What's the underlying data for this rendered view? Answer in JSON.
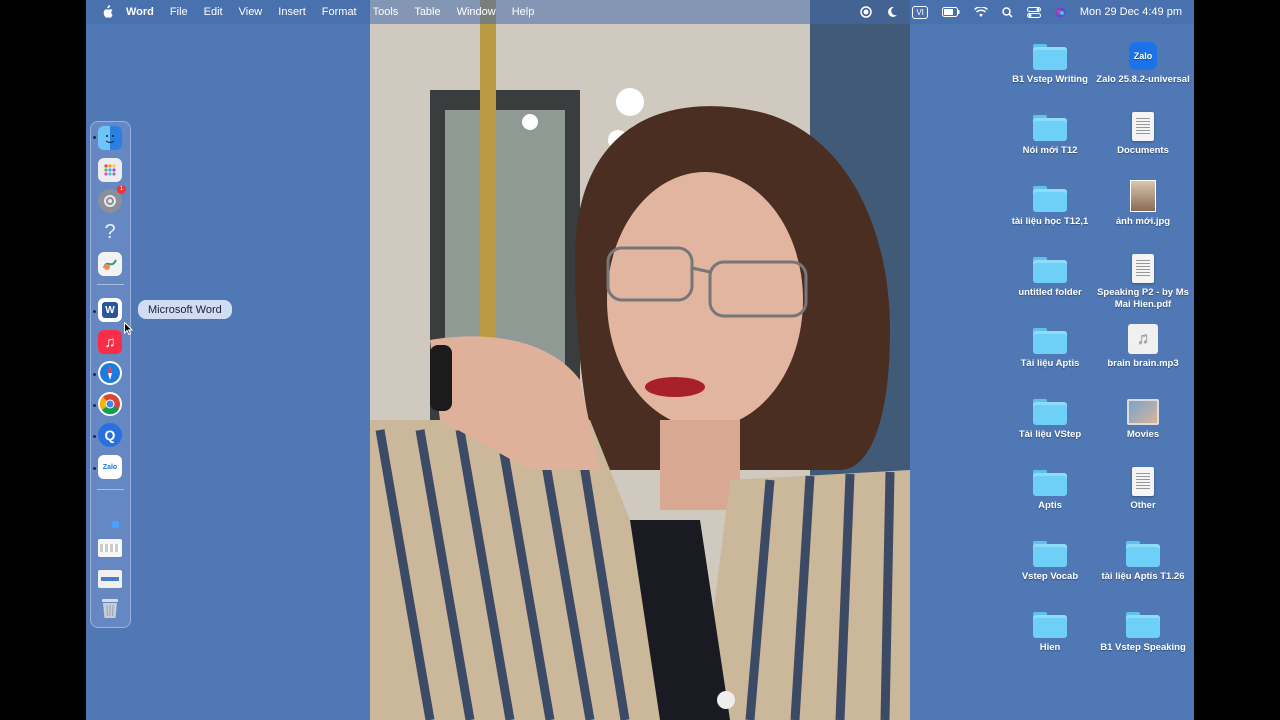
{
  "menubar": {
    "app_name": "Word",
    "menus": [
      "File",
      "Edit",
      "View",
      "Insert",
      "Format",
      "Tools",
      "Table",
      "Window",
      "Help"
    ],
    "input_source": "VI",
    "datetime": "Mon 29 Dec  4:49 pm"
  },
  "dock": {
    "tooltip": "Microsoft Word",
    "apps": [
      {
        "name": "finder-icon",
        "color": "#3a8ee6",
        "label": ""
      },
      {
        "name": "launchpad-icon",
        "color": "#e9e9ee",
        "label": ""
      },
      {
        "name": "system-settings-icon",
        "color": "#8a8f99",
        "label": "",
        "badge": "1"
      },
      {
        "name": "help-icon",
        "color": "transparent",
        "label": "?"
      },
      {
        "name": "freeform-icon",
        "color": "#f4f4f4",
        "label": ""
      },
      {
        "name": "microsoft-word-icon",
        "color": "#2b579a",
        "label": "W"
      },
      {
        "name": "music-icon",
        "color": "#fa2d48",
        "label": "♫"
      },
      {
        "name": "safari-icon",
        "color": "#1f7ae0",
        "label": ""
      },
      {
        "name": "chrome-icon",
        "color": "#ffffff",
        "label": ""
      },
      {
        "name": "quicktime-icon",
        "color": "#2a6fe0",
        "label": "Q"
      },
      {
        "name": "zalo-icon",
        "color": "#ffffff",
        "label": "Zalo"
      }
    ]
  },
  "desktop": {
    "items": [
      {
        "label": "B1 Vstep Writing",
        "type": "folder"
      },
      {
        "label": "Zalo 25.8.2-universal",
        "type": "zalo"
      },
      {
        "label": "Nói mới T12",
        "type": "folder"
      },
      {
        "label": "Documents",
        "type": "doc"
      },
      {
        "label": "tài liệu học T12,1",
        "type": "folder"
      },
      {
        "label": "ảnh mới.jpg",
        "type": "image"
      },
      {
        "label": "untitled folder",
        "type": "folder"
      },
      {
        "label": "Speaking P2 - by Ms Mai Hien.pdf",
        "type": "doc"
      },
      {
        "label": "Tài liệu Aptis",
        "type": "folder"
      },
      {
        "label": "brain brain.mp3",
        "type": "audio"
      },
      {
        "label": "Tài liệu VStep",
        "type": "folder"
      },
      {
        "label": "Movies",
        "type": "movie"
      },
      {
        "label": "Aptis",
        "type": "folder"
      },
      {
        "label": "Other",
        "type": "doc"
      },
      {
        "label": "Vstep Vocab",
        "type": "folder"
      },
      {
        "label": "tài liệu Aptis T1.26",
        "type": "folder"
      },
      {
        "label": "Hien",
        "type": "folder"
      },
      {
        "label": "B1 Vstep Speaking",
        "type": "folder"
      }
    ]
  }
}
